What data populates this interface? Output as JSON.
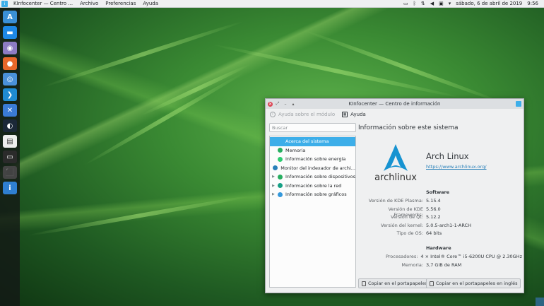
{
  "top_panel": {
    "app_title": "KInfocenter — Centro ...",
    "menus": [
      "Archivo",
      "Preferencias",
      "Ayuda"
    ],
    "clock": "sábado, 6 de abril de 2019",
    "time": "9:56"
  },
  "dock": {
    "items": [
      {
        "name": "dock-archlabs",
        "glyph": "A",
        "color": "#3b8fd6"
      },
      {
        "name": "dock-files",
        "glyph": "▬",
        "color": "#1e88e5"
      },
      {
        "name": "dock-discover",
        "glyph": "◉",
        "color": "#8e7cc3"
      },
      {
        "name": "dock-firefox",
        "glyph": "●",
        "color": "#e8672a"
      },
      {
        "name": "dock-chromium",
        "glyph": "◎",
        "color": "#4a90d9"
      },
      {
        "name": "dock-vscode",
        "glyph": "❯",
        "color": "#1f8ad2"
      },
      {
        "name": "dock-tool",
        "glyph": "✕",
        "color": "#3a7bd5"
      },
      {
        "name": "dock-steam",
        "glyph": "◐",
        "color": "#1b2838"
      },
      {
        "name": "dock-document",
        "glyph": "▤",
        "color": "#eeeeee"
      },
      {
        "name": "dock-terminal",
        "glyph": "▭",
        "color": "#2b2b2b"
      },
      {
        "name": "dock-package",
        "glyph": "⬛",
        "color": "#444444"
      },
      {
        "name": "dock-info",
        "glyph": "i",
        "color": "#2f7fd1"
      }
    ]
  },
  "window": {
    "title": "KInfocenter — Centro de información",
    "toolbar": {
      "help_module": "Ayuda sobre el módulo",
      "help": "Ayuda"
    },
    "search_placeholder": "Buscar",
    "tree": [
      {
        "label": "Acerca del sistema",
        "selected": true,
        "expandable": false,
        "icon_color": "#3daee9"
      },
      {
        "label": "Memoria",
        "selected": false,
        "expandable": false,
        "icon_color": "#27ae60"
      },
      {
        "label": "Información sobre energía",
        "selected": false,
        "expandable": false,
        "icon_color": "#2ecc71"
      },
      {
        "label": "Monitor del indexador de archi...",
        "selected": false,
        "expandable": false,
        "icon_color": "#2980b9"
      },
      {
        "label": "Información sobre dispositivos",
        "selected": false,
        "expandable": true,
        "icon_color": "#27ae60"
      },
      {
        "label": "Información sobre la red",
        "selected": false,
        "expandable": true,
        "icon_color": "#16a085"
      },
      {
        "label": "Información sobre gráficos",
        "selected": false,
        "expandable": true,
        "icon_color": "#3498db"
      }
    ],
    "content": {
      "title": "Información sobre este sistema",
      "distro_name": "Arch Linux",
      "distro_link": "https://www.archlinux.org/",
      "software_heading": "Software",
      "software": [
        {
          "k": "Versión de KDE Plasma:",
          "v": "5.15.4"
        },
        {
          "k": "Versión de KDE Frameworks:",
          "v": "5.56.0"
        },
        {
          "k": "Versión de Qt:",
          "v": "5.12.2"
        },
        {
          "k": "Versión del kernel:",
          "v": "5.0.5-arch1-1-ARCH"
        },
        {
          "k": "Tipo de OS:",
          "v": "64 bits"
        }
      ],
      "hardware_heading": "Hardware",
      "hardware": [
        {
          "k": "Procesadores:",
          "v": "4 × Intel® Core™ i5-6200U CPU @ 2.30GHz"
        },
        {
          "k": "Memoria:",
          "v": "3,7 GiB de RAM"
        }
      ],
      "copy_button": "Copiar en el portapapeles",
      "copy_english_button": "Copiar en el portapapeles en inglés",
      "logo_text": "archlinux"
    }
  }
}
